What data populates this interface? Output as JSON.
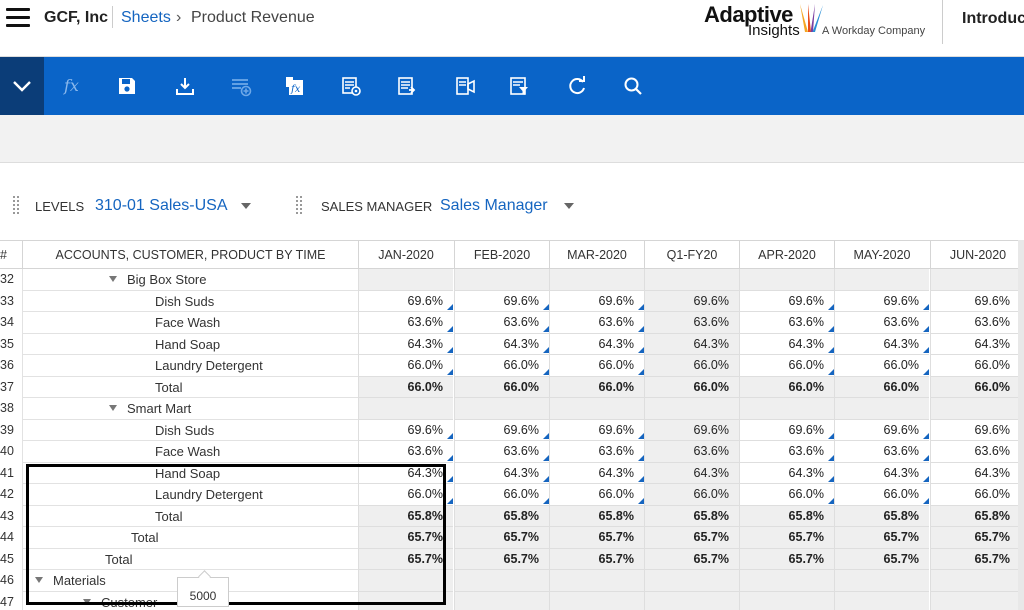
{
  "header": {
    "company": "GCF, Inc",
    "breadcrumb_sheets": "Sheets",
    "breadcrumb_arrow": "›",
    "breadcrumb_page": "Product Revenue",
    "logo_main": "Adaptive",
    "logo_second": "Insights",
    "logo_sub": "A Workday Company",
    "intro": "Introduc"
  },
  "toolbar": {
    "icons": [
      "chevron-down-icon",
      "fx-icon",
      "save-icon",
      "download-icon",
      "add-row-icon",
      "formula-icon",
      "sheet-settings-icon",
      "export-icon",
      "dimension-icon",
      "filter-icon",
      "refresh-icon",
      "search-icon"
    ]
  },
  "levels": {
    "levels_label": "LEVELS",
    "levels_value": "310-01 Sales-USA",
    "manager_label": "SALES MANAGER",
    "manager_value": "Sales Manager"
  },
  "grid": {
    "hash_header": "#",
    "label_header": "ACCOUNTS, CUSTOMER, PRODUCT BY TIME",
    "columns": [
      "JAN-2020",
      "FEB-2020",
      "MAR-2020",
      "Q1-FY20",
      "APR-2020",
      "MAY-2020",
      "JUN-2020"
    ],
    "rows": [
      {
        "num": "32",
        "label": "Big Box Store",
        "indent": 2,
        "expand": true,
        "bold": false,
        "values": [
          "",
          "",
          "",
          "",
          "",
          "",
          ""
        ]
      },
      {
        "num": "33",
        "label": "Dish Suds",
        "indent": 3,
        "expand": false,
        "bold": false,
        "values": [
          "69.6%",
          "69.6%",
          "69.6%",
          "69.6%",
          "69.6%",
          "69.6%",
          "69.6%"
        ]
      },
      {
        "num": "34",
        "label": "Face Wash",
        "indent": 3,
        "expand": false,
        "bold": false,
        "values": [
          "63.6%",
          "63.6%",
          "63.6%",
          "63.6%",
          "63.6%",
          "63.6%",
          "63.6%"
        ]
      },
      {
        "num": "35",
        "label": "Hand Soap",
        "indent": 3,
        "expand": false,
        "bold": false,
        "values": [
          "64.3%",
          "64.3%",
          "64.3%",
          "64.3%",
          "64.3%",
          "64.3%",
          "64.3%"
        ]
      },
      {
        "num": "36",
        "label": "Laundry Detergent",
        "indent": 3,
        "expand": false,
        "bold": false,
        "values": [
          "66.0%",
          "66.0%",
          "66.0%",
          "66.0%",
          "66.0%",
          "66.0%",
          "66.0%"
        ]
      },
      {
        "num": "37",
        "label": "Total",
        "indent": 3,
        "expand": false,
        "bold": true,
        "values": [
          "66.0%",
          "66.0%",
          "66.0%",
          "66.0%",
          "66.0%",
          "66.0%",
          "66.0%"
        ]
      },
      {
        "num": "38",
        "label": "Smart Mart",
        "indent": 2,
        "expand": true,
        "bold": false,
        "values": [
          "",
          "",
          "",
          "",
          "",
          "",
          ""
        ]
      },
      {
        "num": "39",
        "label": "Dish Suds",
        "indent": 3,
        "expand": false,
        "bold": false,
        "values": [
          "69.6%",
          "69.6%",
          "69.6%",
          "69.6%",
          "69.6%",
          "69.6%",
          "69.6%"
        ]
      },
      {
        "num": "40",
        "label": "Face Wash",
        "indent": 3,
        "expand": false,
        "bold": false,
        "values": [
          "63.6%",
          "63.6%",
          "63.6%",
          "63.6%",
          "63.6%",
          "63.6%",
          "63.6%"
        ]
      },
      {
        "num": "41",
        "label": "Hand Soap",
        "indent": 3,
        "expand": false,
        "bold": false,
        "values": [
          "64.3%",
          "64.3%",
          "64.3%",
          "64.3%",
          "64.3%",
          "64.3%",
          "64.3%"
        ]
      },
      {
        "num": "42",
        "label": "Laundry Detergent",
        "indent": 3,
        "expand": false,
        "bold": false,
        "values": [
          "66.0%",
          "66.0%",
          "66.0%",
          "66.0%",
          "66.0%",
          "66.0%",
          "66.0%"
        ]
      },
      {
        "num": "43",
        "label": "Total",
        "indent": 3,
        "expand": false,
        "bold": true,
        "values": [
          "65.8%",
          "65.8%",
          "65.8%",
          "65.8%",
          "65.8%",
          "65.8%",
          "65.8%"
        ]
      },
      {
        "num": "44",
        "label": "Total",
        "indent": 2,
        "expand": false,
        "bold": true,
        "values": [
          "65.7%",
          "65.7%",
          "65.7%",
          "65.7%",
          "65.7%",
          "65.7%",
          "65.7%"
        ]
      },
      {
        "num": "45",
        "label": "Total",
        "indent": 1,
        "expand": false,
        "bold": true,
        "values": [
          "65.7%",
          "65.7%",
          "65.7%",
          "65.7%",
          "65.7%",
          "65.7%",
          "65.7%"
        ]
      },
      {
        "num": "46",
        "label": "Materials",
        "indent": 0,
        "expand": true,
        "bold": false,
        "values": [
          "",
          "",
          "",
          "",
          "",
          "",
          ""
        ]
      },
      {
        "num": "47",
        "label": "Customer",
        "indent": 1,
        "expand": true,
        "bold": false,
        "values": [
          "",
          "",
          "",
          "",
          "",
          "",
          ""
        ]
      }
    ],
    "tooltip": "5000"
  },
  "colors": {
    "toolbar_blue": "#0a64c8",
    "collapse_navy": "#0b3d78",
    "link_blue": "#1565c0"
  }
}
